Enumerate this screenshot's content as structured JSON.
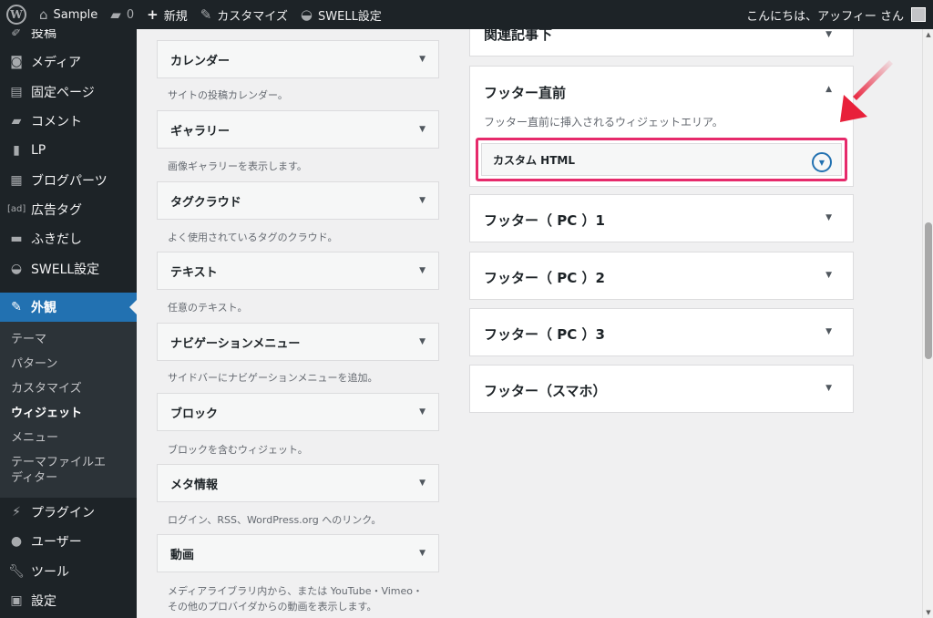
{
  "adminbar": {
    "site_name": "Sample",
    "comments_count": "0",
    "new_label": "新規",
    "customize_label": "カスタマイズ",
    "swell_label": "SWELL設定",
    "greeting": "こんにちは、アッフィー さん"
  },
  "sidebar": {
    "items": [
      {
        "label": "投稿",
        "icon": "pushpin-icon"
      },
      {
        "label": "メディア",
        "icon": "media-icon"
      },
      {
        "label": "固定ページ",
        "icon": "page-icon"
      },
      {
        "label": "コメント",
        "icon": "comment-icon"
      },
      {
        "label": "LP",
        "icon": "document-icon"
      },
      {
        "label": "ブログパーツ",
        "icon": "blogparts-icon"
      },
      {
        "label": "広告タグ",
        "icon": "ad-icon"
      },
      {
        "label": "ふきだし",
        "icon": "bubble-icon"
      },
      {
        "label": "SWELL設定",
        "icon": "swell-icon"
      },
      {
        "label": "外観",
        "icon": "brush-icon"
      }
    ],
    "submenu": [
      "テーマ",
      "パターン",
      "カスタマイズ",
      "ウィジェット",
      "メニュー",
      "テーマファイルエディター"
    ],
    "items_after": [
      {
        "label": "プラグイン",
        "icon": "plugin-icon"
      },
      {
        "label": "ユーザー",
        "icon": "user-icon"
      },
      {
        "label": "ツール",
        "icon": "wrench-icon"
      },
      {
        "label": "設定",
        "icon": "settings-icon"
      }
    ]
  },
  "widgets": [
    {
      "title": "カレンダー",
      "desc": "サイトの投稿カレンダー。"
    },
    {
      "title": "ギャラリー",
      "desc": "画像ギャラリーを表示します。"
    },
    {
      "title": "タグクラウド",
      "desc": "よく使用されているタグのクラウド。"
    },
    {
      "title": "テキスト",
      "desc": "任意のテキスト。"
    },
    {
      "title": "ナビゲーションメニュー",
      "desc": "サイドバーにナビゲーションメニューを追加。"
    },
    {
      "title": "ブロック",
      "desc": "ブロックを含むウィジェット。"
    },
    {
      "title": "メタ情報",
      "desc": "ログイン、RSS、WordPress.org へのリンク。"
    },
    {
      "title": "動画",
      "desc": "メディアライブラリ内から、または YouTube・Vimeo・",
      "desc2": "その他のプロバイダからの動画を表示します。"
    }
  ],
  "areas": {
    "related": {
      "title": "関連記事下"
    },
    "footer_before": {
      "title": "フッター直前",
      "desc": "フッター直前に挿入されるウィジェットエリア。",
      "widget_title": "カスタム HTML"
    },
    "others": [
      {
        "title": "フッター（ PC ）1"
      },
      {
        "title": "フッター（ PC ）2"
      },
      {
        "title": "フッター（ PC ）3"
      },
      {
        "title": "フッター（スマホ）"
      }
    ]
  },
  "colors": {
    "adminbar_bg": "#1d2327",
    "active_menu": "#2271b1",
    "highlight_border": "#e62a6b",
    "annotation_arrow": "#e8203a"
  }
}
